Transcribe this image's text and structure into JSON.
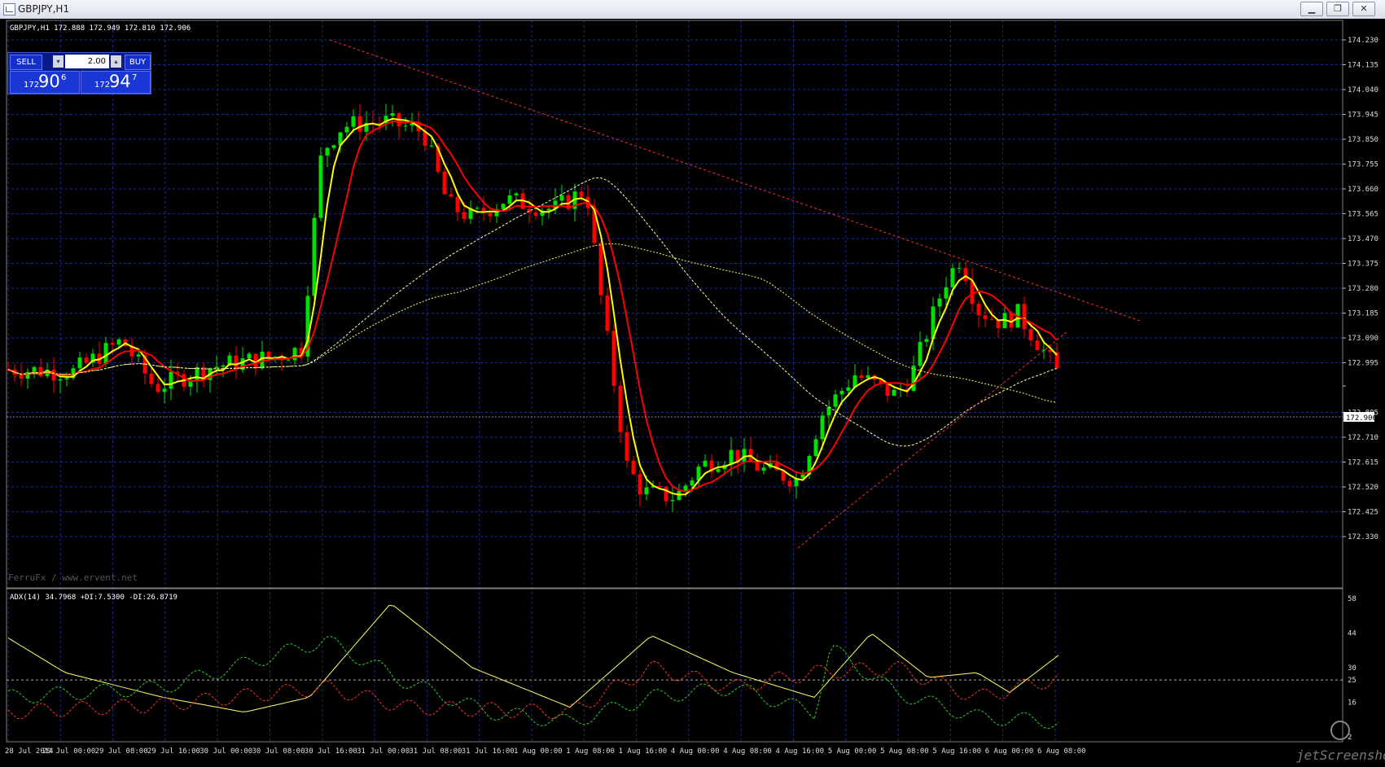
{
  "window": {
    "title": "GBPJPY,H1",
    "buttons": [
      "minimize",
      "restore",
      "close"
    ]
  },
  "chart": {
    "header": "GBPJPY,H1  172.888 172.949 172.810 172.906",
    "watermark": "FerruFx / www.ervent.net",
    "price_axis": [
      "174.230",
      "174.135",
      "174.040",
      "173.945",
      "173.850",
      "173.755",
      "173.660",
      "173.565",
      "173.470",
      "173.375",
      "173.280",
      "173.185",
      "173.090",
      "172.995",
      "172.906",
      "172.805",
      "172.710",
      "172.615",
      "172.520",
      "172.425",
      "172.330"
    ],
    "current_price": "172.906",
    "time_axis": [
      "28 Jul 2014",
      "29 Jul 00:00",
      "29 Jul 08:00",
      "29 Jul 16:00",
      "30 Jul 00:00",
      "30 Jul 08:00",
      "30 Jul 16:00",
      "31 Jul 00:00",
      "31 Jul 08:00",
      "31 Jul 16:00",
      "1 Aug 00:00",
      "1 Aug 08:00",
      "1 Aug 16:00",
      "4 Aug 00:00",
      "4 Aug 08:00",
      "4 Aug 16:00",
      "5 Aug 00:00",
      "5 Aug 08:00",
      "5 Aug 16:00",
      "6 Aug 00:00",
      "6 Aug 08:00"
    ],
    "colors": {
      "bull": "#00e000",
      "bear": "#ff0000",
      "ma_fast": "#ffff00",
      "ma_slow": "#ff0000",
      "grid": "#1a2c8c"
    }
  },
  "trade_panel": {
    "sell_label": "SELL",
    "buy_label": "BUY",
    "lot": "2.00",
    "sell_price": {
      "small": "172",
      "big": "90",
      "sup": "6"
    },
    "buy_price": {
      "small": "172",
      "big": "94",
      "sup": "7"
    }
  },
  "indicator": {
    "label": "ADX(14) 34.7968 +DI:7.5300 -DI:26.8719",
    "axis": [
      "58",
      "44",
      "30",
      "25",
      "16",
      "2"
    ]
  },
  "footer": {
    "brand": "jetScreenshot"
  }
}
